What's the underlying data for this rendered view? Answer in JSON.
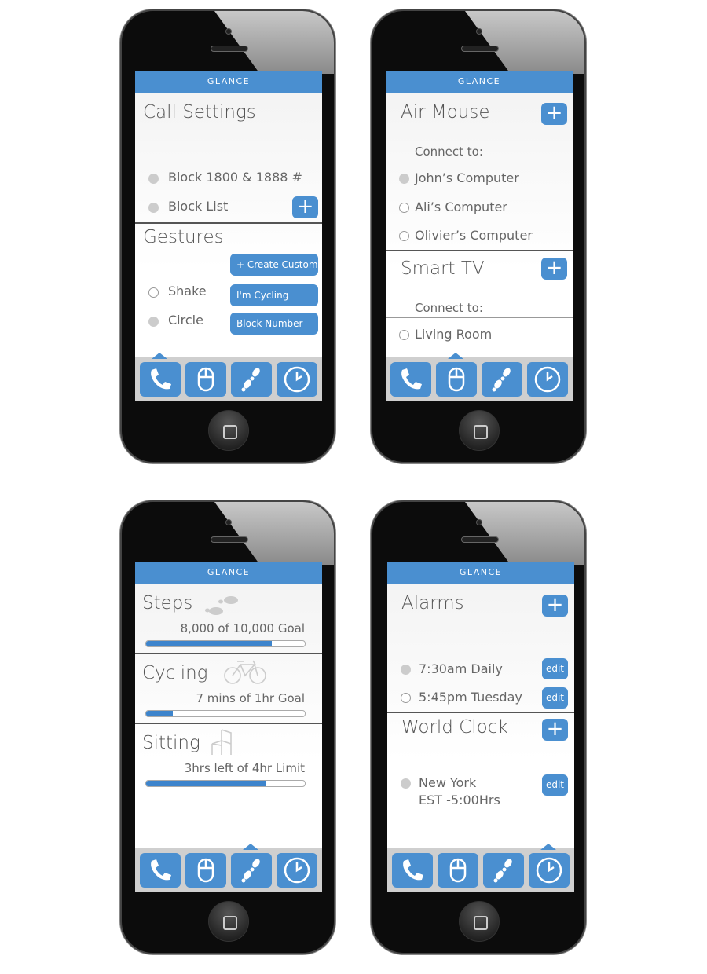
{
  "app_title": "GLANCE",
  "colors": {
    "accent": "#4a8fd0"
  },
  "tabs": [
    {
      "icon": "phone-icon"
    },
    {
      "icon": "mouse-icon"
    },
    {
      "icon": "footsteps-icon"
    },
    {
      "icon": "clock-icon"
    }
  ],
  "call": {
    "title": "Call Settings",
    "items": [
      {
        "label": "Block 1800 & 1888 #",
        "selected": true
      },
      {
        "label": "Block List",
        "selected": true
      }
    ],
    "gestures_title": "Gestures",
    "gestures": [
      {
        "label": "Shake",
        "selected": false,
        "action": "I'm Cycling"
      },
      {
        "label": "Circle",
        "selected": true,
        "action": "Block Number"
      }
    ],
    "create_custom": "+ Create Custom",
    "plus": "+"
  },
  "remote": {
    "air_title": "Air Mouse",
    "connect": "Connect to:",
    "computers": [
      {
        "label": "John’s Computer",
        "selected": true
      },
      {
        "label": "Ali’s Computer",
        "selected": false
      },
      {
        "label": "Olivier’s Computer",
        "selected": false
      }
    ],
    "tv_title": "Smart TV",
    "tvs": [
      {
        "label": "Living Room",
        "selected": false
      }
    ],
    "plus": "+"
  },
  "activity": [
    {
      "title": "Steps",
      "icon": "footsteps-icon",
      "status": "8,000 of 10,000 Goal",
      "progress": 0.79
    },
    {
      "title": "Cycling",
      "icon": "bicycle-icon",
      "status": "7 mins of 1hr Goal",
      "progress": 0.17
    },
    {
      "title": "Sitting",
      "icon": "chair-icon",
      "status": "3hrs left of 4hr Limit",
      "progress": 0.75
    }
  ],
  "clock": {
    "alarms_title": "Alarms",
    "alarms": [
      {
        "label": "7:30am Daily",
        "selected": true
      },
      {
        "label": "5:45pm Tuesday",
        "selected": false
      }
    ],
    "world_title": "World Clock",
    "cities": [
      {
        "label": "New York",
        "tz": "EST -5:00Hrs",
        "selected": true
      }
    ],
    "edit": "edit",
    "plus": "+"
  }
}
